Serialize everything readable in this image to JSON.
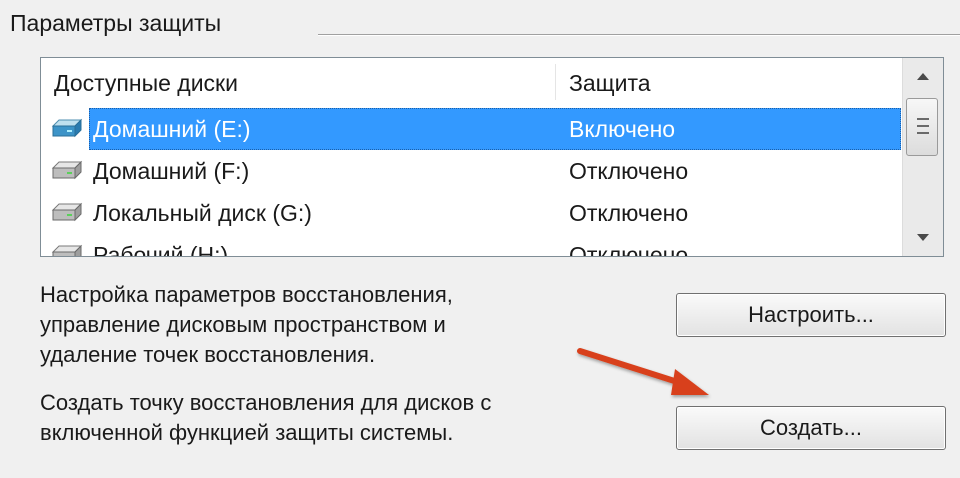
{
  "group": {
    "title": "Параметры защиты"
  },
  "list": {
    "columns": {
      "disks": "Доступные диски",
      "protection": "Защита"
    },
    "rows": [
      {
        "name": "Домашний (E:)",
        "status": "Включено",
        "icon": "drive-protected-icon",
        "selected": true
      },
      {
        "name": "Домашний (F:)",
        "status": "Отключено",
        "icon": "drive-icon",
        "selected": false
      },
      {
        "name": "Локальный диск (G:)",
        "status": "Отключено",
        "icon": "drive-icon",
        "selected": false
      },
      {
        "name": "Рабочий (H:)",
        "status": "Отключено",
        "icon": "drive-icon",
        "selected": false
      }
    ]
  },
  "configure": {
    "description": [
      "Настройка параметров восстановления,",
      "управление дисковым пространством и",
      "удаление точек восстановления."
    ],
    "button_label": "Настроить..."
  },
  "create": {
    "description": [
      "Создать точку восстановления для дисков с",
      "включенной функцией защиты системы."
    ],
    "button_label": "Создать..."
  },
  "colors": {
    "selection": "#3399ff",
    "arrow": "#d8401a"
  }
}
